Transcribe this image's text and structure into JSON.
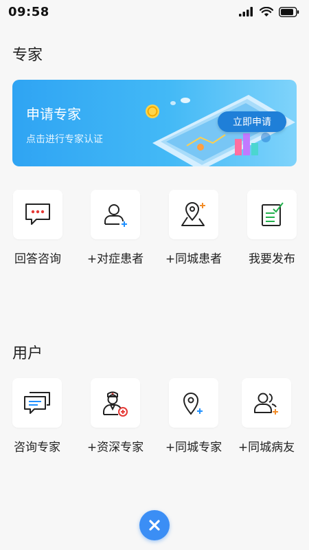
{
  "status_bar": {
    "time": "09:58"
  },
  "expert_section": {
    "title": "专家",
    "banner": {
      "title": "申请专家",
      "subtitle": "点击进行专家认证",
      "button_label": "立即申请"
    },
    "items": [
      {
        "label": "回答咨询",
        "icon": "chat-bubble-icon"
      },
      {
        "label": "+对症患者",
        "icon": "user-add-icon"
      },
      {
        "label": "+同城患者",
        "icon": "map-pin-add-icon"
      },
      {
        "label": "我要发布",
        "icon": "edit-note-icon"
      }
    ]
  },
  "user_section": {
    "title": "用户",
    "items": [
      {
        "label": "咨询专家",
        "icon": "chat-messages-icon"
      },
      {
        "label": "+资深专家",
        "icon": "nurse-add-icon"
      },
      {
        "label": "+同城专家",
        "icon": "location-add-icon"
      },
      {
        "label": "+同城病友",
        "icon": "users-add-icon"
      }
    ]
  },
  "close_button": {
    "icon": "close-icon"
  },
  "colors": {
    "accent": "#3b8ef5",
    "banner_start": "#2fa4f3",
    "banner_end": "#7fd3fb",
    "plus_blue": "#1e90ff",
    "plus_orange": "#f28c28",
    "plus_red": "#e53935",
    "check_green": "#22b14c",
    "dots_red": "#e53935"
  }
}
